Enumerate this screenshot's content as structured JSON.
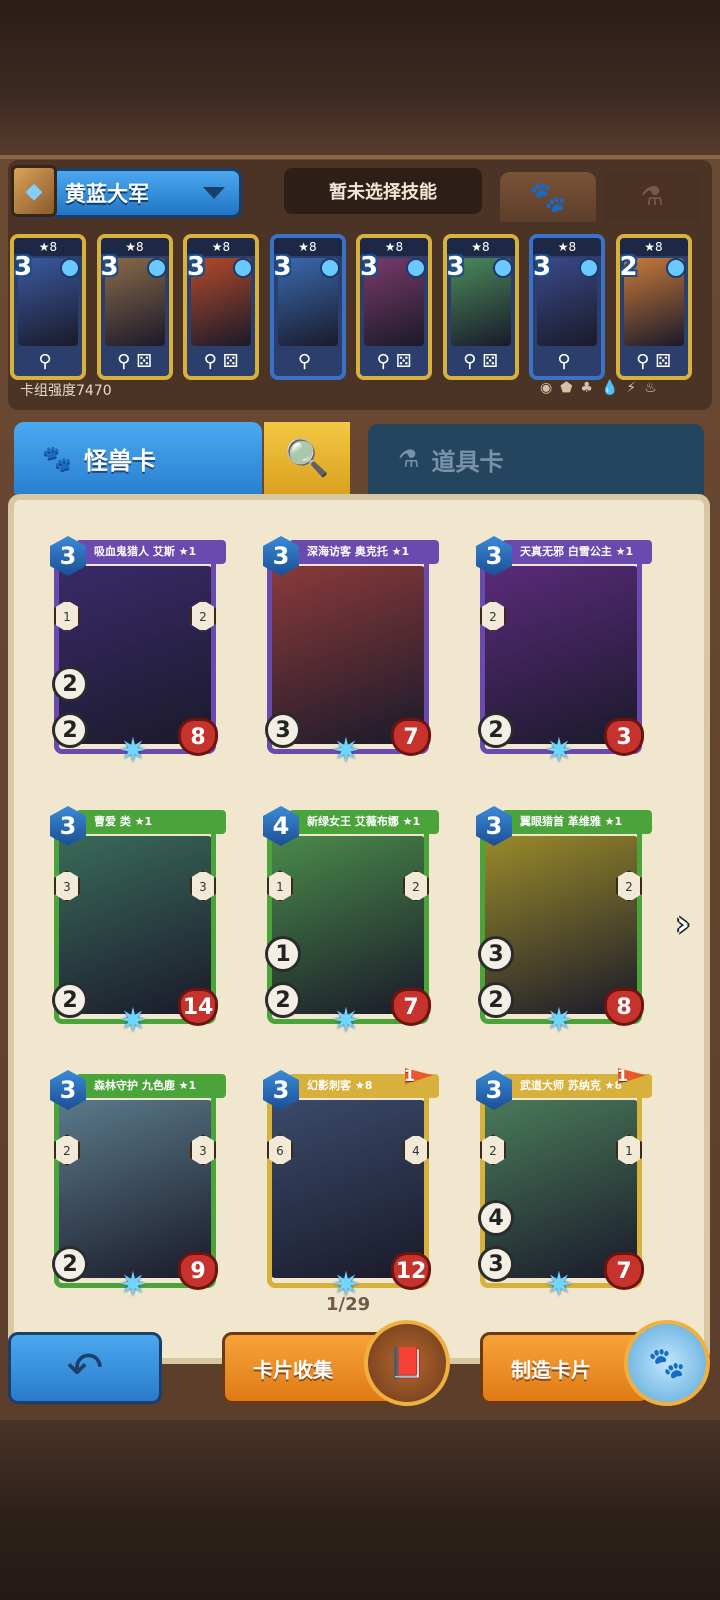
{
  "deck": {
    "name": "黄蓝大军",
    "skill_label": "暂未选择技能",
    "power_label": "卡组强度7470"
  },
  "tabs": {
    "monster_label": "怪兽卡",
    "item_label": "道具卡"
  },
  "deck_cards": [
    {
      "level": "★8",
      "cost": "3",
      "frame": "#d8b13c",
      "art": "#3a5aa0",
      "foot": ""
    },
    {
      "level": "★8",
      "cost": "3",
      "frame": "#d8b13c",
      "art": "#8a6a4a",
      "foot": "⚄"
    },
    {
      "level": "★8",
      "cost": "3",
      "frame": "#d8b13c",
      "art": "#b24a2a",
      "foot": "⚄"
    },
    {
      "level": "★8",
      "cost": "3",
      "frame": "#3a72c8",
      "art": "#3a6ab0",
      "foot": ""
    },
    {
      "level": "★8",
      "cost": "3",
      "frame": "#d8b13c",
      "art": "#7a3a6a",
      "foot": "⚄"
    },
    {
      "level": "★8",
      "cost": "3",
      "frame": "#d8b13c",
      "art": "#4a8a5a",
      "foot": "⚄"
    },
    {
      "level": "★8",
      "cost": "3",
      "frame": "#3a72c8",
      "art": "#3a4a8a",
      "foot": ""
    },
    {
      "level": "★8",
      "cost": "2",
      "frame": "#d8b13c",
      "art": "#c87a3a",
      "foot": "⚄"
    }
  ],
  "cards": [
    {
      "name": "吸血鬼猎人 艾斯 ★1",
      "cost": "3",
      "atk": "2",
      "def": "2",
      "hp": "8",
      "frame": "#6b4ab0",
      "art": "#3a2a6a",
      "h1": "1",
      "h2": "2"
    },
    {
      "name": "深海访客 奥克托 ★1",
      "cost": "3",
      "atk": "",
      "def": "3",
      "hp": "7",
      "frame": "#6b4ab0",
      "art": "#8a3a3a",
      "h1": "",
      "h2": ""
    },
    {
      "name": "天真无邪 白雪公主 ★1",
      "cost": "3",
      "atk": "",
      "def": "2",
      "hp": "3",
      "frame": "#6b4ab0",
      "art": "#5a2a7a",
      "h1": "2",
      "h2": ""
    },
    {
      "name": "曹爱 类 ★1",
      "cost": "3",
      "atk": "",
      "def": "2",
      "hp": "14",
      "frame": "#4aa43a",
      "art": "#3a6a5a",
      "h1": "3",
      "h2": "3"
    },
    {
      "name": "新绿女王 艾薇布娜 ★1",
      "cost": "4",
      "atk": "1",
      "def": "2",
      "hp": "7",
      "frame": "#4aa43a",
      "art": "#4a8a4a",
      "h1": "1",
      "h2": "2"
    },
    {
      "name": "翼眼猎首 革维雅 ★1",
      "cost": "3",
      "atk": "3",
      "def": "2",
      "hp": "8",
      "frame": "#4aa43a",
      "art": "#9a8a2a",
      "h1": "",
      "h2": "2"
    },
    {
      "name": "森林守护 九色鹿 ★1",
      "cost": "3",
      "atk": "",
      "def": "2",
      "hp": "9",
      "frame": "#4aa43a",
      "art": "#5a7a8a",
      "h1": "2",
      "h2": "3"
    },
    {
      "name": "幻影刺客 ★8",
      "cost": "3",
      "atk": "",
      "def": "",
      "hp": "12",
      "frame": "#d8b13c",
      "art": "#3a4a6a",
      "h1": "6",
      "h2": "4",
      "flag": "1"
    },
    {
      "name": "武道大师 苏纳克 ★8",
      "cost": "3",
      "atk": "4",
      "def": "3",
      "hp": "7",
      "frame": "#d8b13c",
      "art": "#4a7a5a",
      "h1": "2",
      "h2": "1",
      "flag": "1"
    }
  ],
  "page_indicator": "1/29",
  "buttons": {
    "collect_label": "卡片收集",
    "craft_label": "制造卡片"
  },
  "icons": {
    "paw": "paw-icon",
    "potion": "potion-icon",
    "search": "search-icon",
    "back": "back-arrow-icon"
  }
}
